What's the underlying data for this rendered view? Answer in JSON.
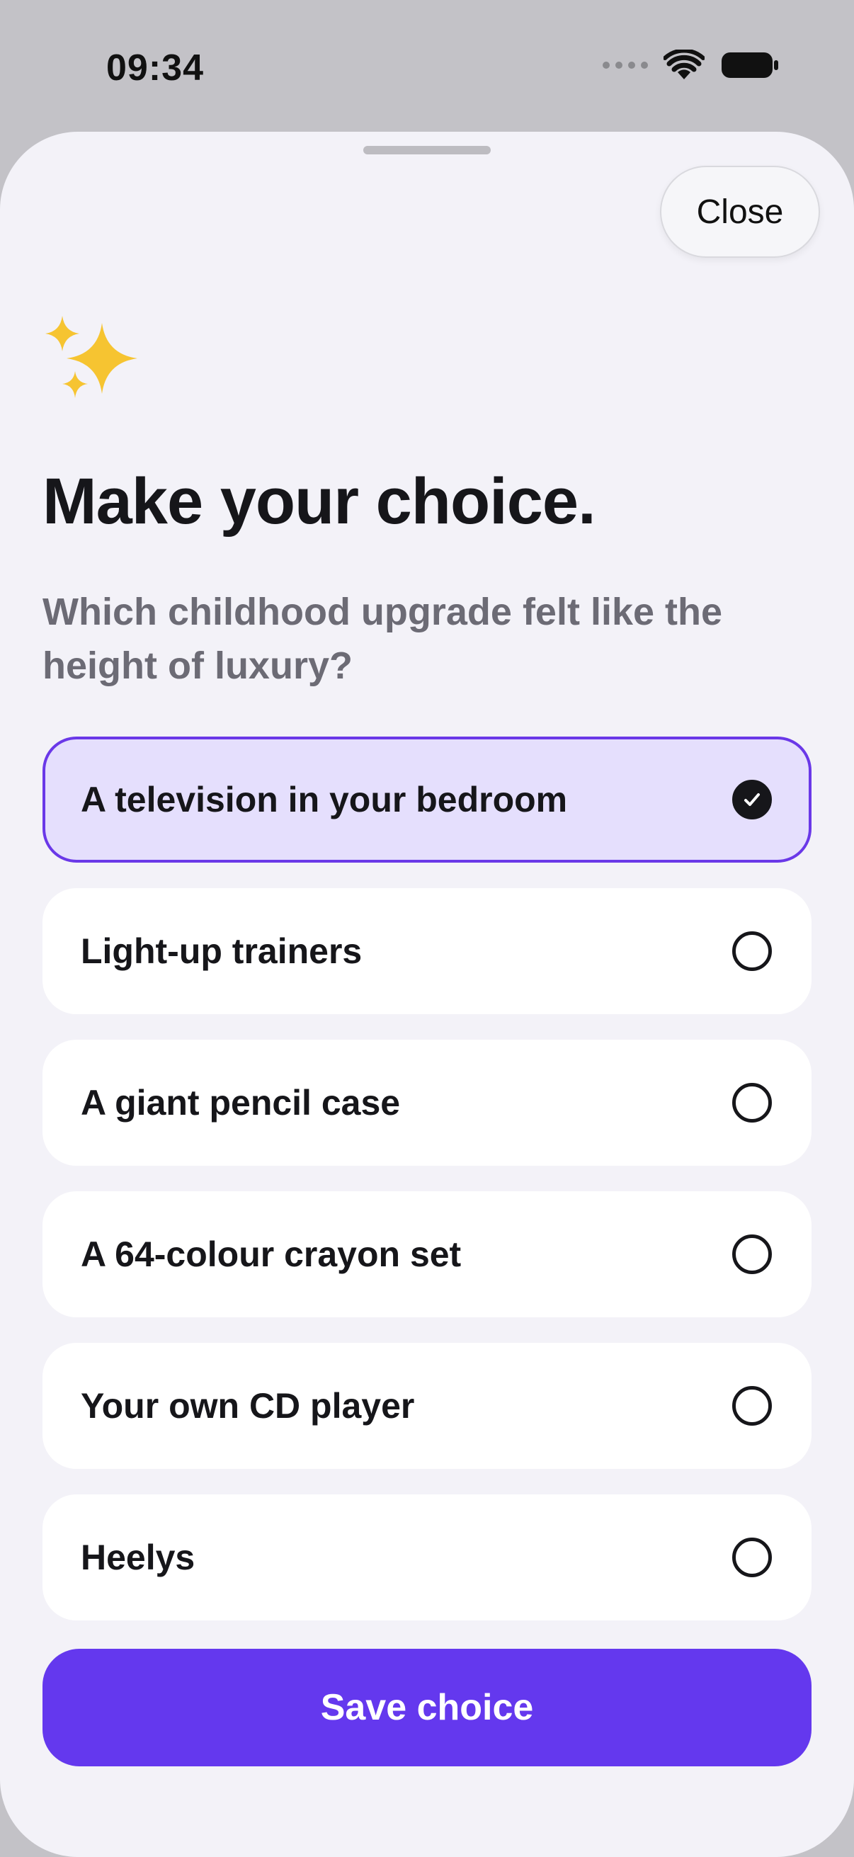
{
  "status_bar": {
    "time": "09:34",
    "icons": [
      "cellular-signal-icon",
      "wifi-icon",
      "battery-icon"
    ]
  },
  "sheet": {
    "close_label": "Close",
    "header_icon": "sparkles-icon",
    "title": "Make your choice.",
    "question": "Which childhood upgrade felt like the height of luxury?",
    "options": [
      {
        "label": "A television in your bedroom",
        "selected": true
      },
      {
        "label": "Light-up trainers",
        "selected": false
      },
      {
        "label": "A giant pencil case",
        "selected": false
      },
      {
        "label": "A 64-colour crayon set",
        "selected": false
      },
      {
        "label": "Your own CD player",
        "selected": false
      },
      {
        "label": "Heelys",
        "selected": false
      }
    ],
    "save_label": "Save choice"
  },
  "colors": {
    "accent": "#6438EE",
    "selected_background": "#E5DFFD",
    "selected_border": "#6A38E8",
    "sheet_background": "#F3F2F8",
    "sparkle": "#F6C431"
  }
}
